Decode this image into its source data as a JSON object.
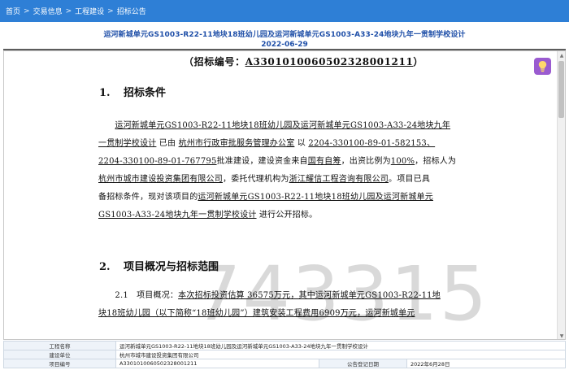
{
  "breadcrumb": {
    "items": [
      "首页",
      "交易信息",
      "工程建设",
      "招标公告"
    ],
    "separator": ">"
  },
  "document": {
    "title": "运河新城单元GS1003-R22-11地块18班幼儿园及运河新城单元GS1003-A33-24地块九年一贯制学校设计",
    "date": "2022-06-29",
    "code_prefix": "（招标编号：",
    "code_number": "A3301010060502328001211",
    "code_suffix": "）",
    "section1_no": "1.",
    "section1_title": "招标条件",
    "section2_no": "2.",
    "section2_title": "项目概况与招标范围",
    "p1": {
      "l1": "运河新城单元GS1003-R22-11地块18班幼儿园及运河新城单元GS1003-A33-24地块九年",
      "l2a": "一贯制学校设计",
      "l2b": "已由",
      "l2c": "杭州市行政审批服务管理办公室",
      "l2d": "以",
      "l2e": "2204-330100-89-01-582153、",
      "l3a": "2204-330100-89-01-767795",
      "l3b": "批准建设，建设资金来自",
      "l3c": "国有自筹",
      "l3d": "，出资比例为",
      "l3e": "100%",
      "l3f": "，招标人为",
      "l4a": "杭州市城市建设投资集团有限公司",
      "l4b": "，委托代理机构为",
      "l4c": "浙江耀信工程咨询有限公司",
      "l4d": "。项目已具",
      "l5a": "备招标条件，现对该项目的",
      "l5b": "运河新城单元GS1003-R22-11地块18班幼儿园及运河新城单元",
      "l6a": "GS1003-A33-24地块九年一贯制学校设计",
      "l6b": "进行公开招标。"
    },
    "p2": {
      "l1a": "2.1　项目概况：",
      "l1b": "本次招标投资估算 36575万元，其中运河新城单元GS1003-R22-11地",
      "l2": "块18班幼儿园（以下简称“18班幼儿园”）建筑安装工程费用6909万元，运河新城单元"
    },
    "watermark": "743315"
  },
  "info_table": {
    "rows": [
      {
        "label": "工程名称",
        "value": "运河新城单元GS1003-R22-11地块18班幼儿园及运河新城单元GS1003-A33-24地块九年一贯制学校设计"
      },
      {
        "label": "建设单位",
        "value": "杭州市城市建设投资集团有限公司"
      },
      {
        "label": "项目编号",
        "value": "A3301010060502328001211",
        "label2": "公告登记日期",
        "value2": "2022年6月28日"
      }
    ]
  },
  "colors": {
    "nav_bg": "#2e7fd6",
    "title_text": "#1f4fa8",
    "hint_button": "#9a5bd0"
  },
  "icons": {
    "hint": "lightbulb-icon"
  }
}
